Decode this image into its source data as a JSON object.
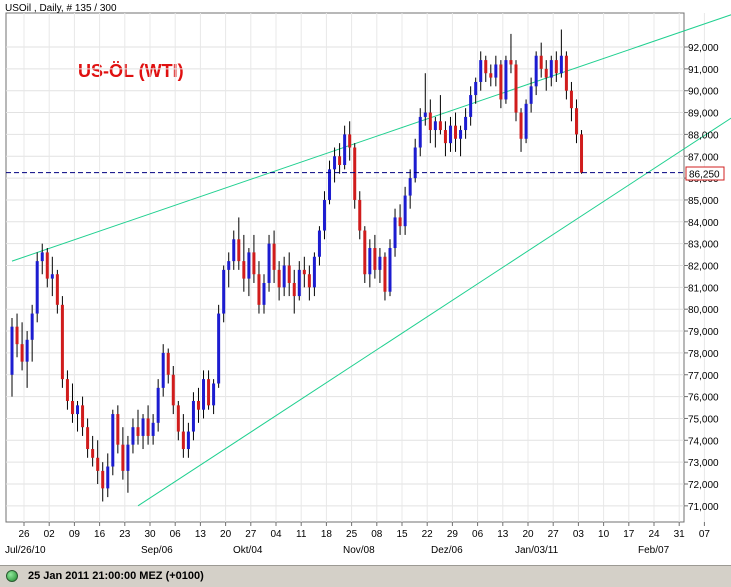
{
  "header": {
    "info": "USOil , Daily, # 135 / 300"
  },
  "status": {
    "timestamp": "25 Jan 2011 21:00:00  MEZ (+0100)"
  },
  "chart_data": {
    "type": "candlestick",
    "title": "US-ÖL (WTI)",
    "ylim": [
      70.5,
      93
    ],
    "y_ticks": [
      "92,000",
      "91,000",
      "90,000",
      "89,000",
      "88,000",
      "87,000",
      "86,000",
      "85,000",
      "84,000",
      "83,000",
      "82,000",
      "81,000",
      "80,000",
      "79,000",
      "78,000",
      "77,000",
      "76,000",
      "75,000",
      "74,000",
      "73,000",
      "72,000",
      "71,000"
    ],
    "x_ticks": [
      "26",
      "02",
      "09",
      "16",
      "23",
      "30",
      "06",
      "13",
      "20",
      "27",
      "04",
      "11",
      "18",
      "25",
      "08",
      "15",
      "22",
      "29",
      "06",
      "13",
      "20",
      "27",
      "03",
      "10",
      "17",
      "24",
      "31",
      "07"
    ],
    "x_month_labels": [
      "Jul/26/10",
      "Sep/06",
      "Okt/04",
      "Nov/08",
      "Dez/06",
      "Jan/03/11",
      "Feb/07"
    ],
    "current_price": "86,250",
    "current_price_value": 86.25,
    "colors": {
      "up": "#1c1cd0",
      "down": "#d01c1c",
      "trend": "#20d090",
      "price_line": "#000080",
      "title": "#e01010"
    },
    "candles": [
      [
        77.0,
        79.6,
        76.0,
        79.2
      ],
      [
        79.2,
        79.8,
        77.8,
        78.4
      ],
      [
        78.4,
        79.4,
        77.2,
        77.6
      ],
      [
        77.6,
        79.0,
        76.4,
        78.6
      ],
      [
        78.6,
        80.2,
        77.6,
        79.8
      ],
      [
        79.8,
        82.6,
        79.4,
        82.2
      ],
      [
        82.2,
        83.0,
        81.6,
        82.6
      ],
      [
        82.6,
        82.8,
        81.0,
        81.4
      ],
      [
        81.4,
        82.4,
        80.6,
        81.6
      ],
      [
        81.6,
        81.8,
        79.8,
        80.2
      ],
      [
        80.2,
        80.6,
        76.4,
        76.8
      ],
      [
        76.8,
        77.2,
        75.4,
        75.8
      ],
      [
        75.8,
        76.6,
        74.8,
        75.2
      ],
      [
        75.2,
        75.8,
        74.4,
        75.6
      ],
      [
        75.6,
        76.0,
        74.2,
        74.6
      ],
      [
        74.6,
        75.0,
        73.2,
        73.6
      ],
      [
        73.6,
        74.2,
        72.8,
        73.2
      ],
      [
        73.2,
        74.0,
        72.0,
        72.6
      ],
      [
        72.6,
        73.0,
        71.2,
        71.8
      ],
      [
        71.8,
        73.4,
        71.4,
        72.8
      ],
      [
        72.8,
        75.4,
        72.4,
        75.2
      ],
      [
        75.2,
        75.6,
        73.4,
        73.8
      ],
      [
        73.8,
        74.6,
        72.2,
        72.6
      ],
      [
        72.6,
        74.2,
        71.6,
        73.8
      ],
      [
        73.8,
        75.0,
        73.4,
        74.6
      ],
      [
        74.6,
        75.4,
        73.8,
        74.2
      ],
      [
        74.2,
        75.2,
        73.6,
        75.0
      ],
      [
        75.0,
        75.6,
        73.8,
        74.2
      ],
      [
        74.2,
        75.2,
        73.8,
        74.8
      ],
      [
        74.8,
        76.8,
        74.4,
        76.4
      ],
      [
        76.4,
        78.4,
        76.0,
        78.0
      ],
      [
        78.0,
        78.2,
        76.6,
        77.0
      ],
      [
        77.0,
        77.4,
        75.2,
        75.6
      ],
      [
        75.6,
        75.8,
        74.0,
        74.4
      ],
      [
        74.4,
        75.2,
        73.2,
        73.6
      ],
      [
        73.6,
        74.8,
        73.2,
        74.4
      ],
      [
        74.4,
        76.2,
        74.0,
        75.8
      ],
      [
        75.8,
        76.4,
        74.8,
        75.4
      ],
      [
        75.4,
        77.2,
        75.0,
        76.8
      ],
      [
        76.8,
        77.2,
        75.4,
        75.6
      ],
      [
        75.6,
        76.8,
        75.2,
        76.6
      ],
      [
        76.6,
        80.2,
        76.4,
        79.8
      ],
      [
        79.8,
        82.0,
        79.4,
        81.8
      ],
      [
        81.8,
        82.6,
        81.0,
        82.2
      ],
      [
        82.2,
        83.6,
        81.8,
        83.2
      ],
      [
        83.2,
        84.2,
        81.8,
        82.2
      ],
      [
        82.2,
        83.4,
        80.8,
        81.4
      ],
      [
        81.4,
        82.8,
        80.6,
        82.6
      ],
      [
        82.6,
        83.4,
        81.2,
        81.6
      ],
      [
        81.6,
        82.2,
        79.8,
        80.2
      ],
      [
        80.2,
        81.6,
        79.8,
        81.2
      ],
      [
        81.2,
        83.4,
        80.8,
        83.0
      ],
      [
        83.0,
        83.6,
        81.2,
        81.8
      ],
      [
        81.8,
        82.2,
        80.4,
        81.0
      ],
      [
        81.0,
        82.4,
        80.6,
        82.0
      ],
      [
        82.0,
        82.6,
        80.6,
        81.2
      ],
      [
        81.2,
        81.8,
        79.8,
        80.6
      ],
      [
        80.6,
        82.2,
        80.4,
        81.8
      ],
      [
        81.8,
        82.4,
        81.0,
        81.6
      ],
      [
        81.6,
        82.0,
        80.4,
        81.0
      ],
      [
        81.0,
        82.6,
        80.6,
        82.4
      ],
      [
        82.4,
        83.8,
        82.0,
        83.6
      ],
      [
        83.6,
        85.4,
        83.2,
        85.0
      ],
      [
        85.0,
        86.8,
        84.8,
        86.4
      ],
      [
        86.4,
        87.4,
        85.8,
        87.0
      ],
      [
        87.0,
        87.6,
        86.2,
        86.6
      ],
      [
        86.6,
        88.4,
        86.4,
        88.0
      ],
      [
        88.0,
        88.6,
        86.8,
        87.4
      ],
      [
        87.4,
        87.6,
        84.6,
        85.0
      ],
      [
        85.0,
        85.4,
        83.2,
        83.6
      ],
      [
        83.6,
        83.8,
        81.2,
        81.6
      ],
      [
        81.6,
        83.2,
        81.0,
        82.8
      ],
      [
        82.8,
        83.4,
        81.4,
        81.8
      ],
      [
        81.8,
        82.8,
        81.2,
        82.4
      ],
      [
        82.4,
        82.6,
        80.4,
        80.8
      ],
      [
        80.8,
        83.2,
        80.6,
        82.8
      ],
      [
        82.8,
        84.6,
        82.4,
        84.2
      ],
      [
        84.2,
        84.8,
        83.4,
        83.8
      ],
      [
        83.8,
        85.6,
        83.4,
        85.2
      ],
      [
        85.2,
        86.4,
        84.6,
        86.0
      ],
      [
        86.0,
        87.8,
        85.8,
        87.4
      ],
      [
        87.4,
        89.2,
        87.0,
        88.8
      ],
      [
        88.8,
        90.8,
        88.4,
        89.0
      ],
      [
        89.0,
        89.6,
        87.6,
        88.2
      ],
      [
        88.2,
        88.8,
        87.4,
        88.6
      ],
      [
        88.6,
        89.8,
        88.0,
        88.2
      ],
      [
        88.2,
        88.6,
        87.0,
        87.6
      ],
      [
        87.6,
        88.8,
        87.2,
        88.4
      ],
      [
        88.4,
        89.0,
        87.2,
        87.8
      ],
      [
        87.8,
        88.4,
        87.0,
        88.2
      ],
      [
        88.2,
        89.2,
        87.8,
        88.8
      ],
      [
        88.8,
        90.2,
        88.4,
        89.8
      ],
      [
        89.8,
        90.6,
        89.4,
        90.4
      ],
      [
        90.4,
        91.8,
        90.0,
        91.4
      ],
      [
        91.4,
        91.6,
        90.4,
        90.8
      ],
      [
        90.8,
        91.2,
        90.2,
        90.6
      ],
      [
        90.6,
        91.6,
        90.2,
        91.2
      ],
      [
        91.2,
        91.4,
        89.2,
        89.6
      ],
      [
        89.6,
        91.6,
        89.4,
        91.4
      ],
      [
        91.4,
        92.6,
        90.8,
        91.2
      ],
      [
        91.2,
        91.4,
        88.6,
        89.0
      ],
      [
        89.0,
        89.2,
        87.2,
        87.8
      ],
      [
        87.8,
        89.6,
        87.6,
        89.4
      ],
      [
        89.4,
        90.6,
        89.0,
        90.2
      ],
      [
        90.2,
        91.8,
        89.8,
        91.6
      ],
      [
        91.6,
        92.2,
        90.6,
        91.0
      ],
      [
        91.0,
        91.4,
        90.0,
        90.6
      ],
      [
        90.6,
        91.6,
        90.2,
        91.4
      ],
      [
        91.4,
        91.8,
        90.4,
        90.8
      ],
      [
        90.8,
        92.8,
        90.6,
        91.6
      ],
      [
        91.6,
        91.8,
        89.6,
        90.0
      ],
      [
        90.0,
        90.4,
        88.6,
        89.2
      ],
      [
        89.2,
        89.6,
        87.6,
        88.0
      ],
      [
        88.0,
        88.2,
        86.2,
        86.25
      ]
    ],
    "trendlines": [
      {
        "start": [
          0,
          82.2
        ],
        "end": [
          143,
          93.5
        ]
      },
      {
        "start": [
          25,
          71.0
        ],
        "end": [
          151,
          90.0
        ]
      }
    ]
  }
}
